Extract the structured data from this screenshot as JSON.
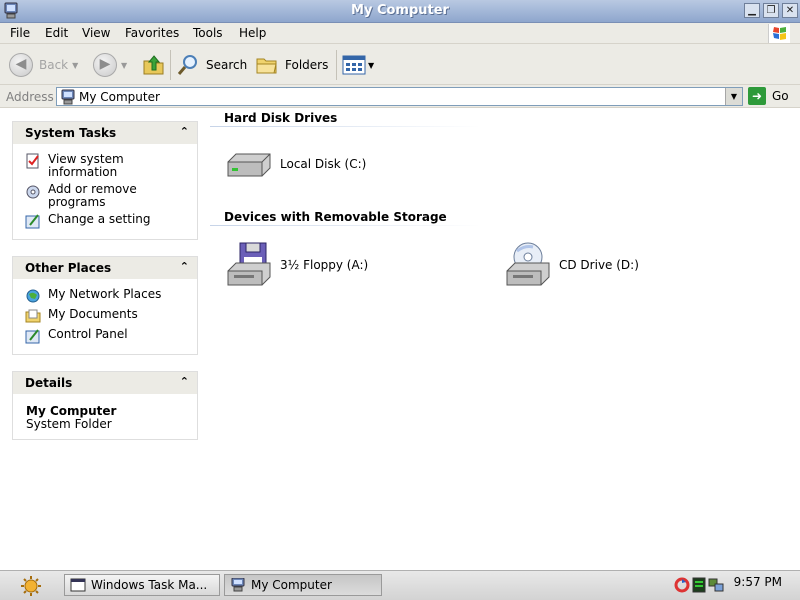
{
  "window": {
    "title": "My Computer",
    "controls": [
      "minimize",
      "restore",
      "close"
    ]
  },
  "menubar": {
    "items": [
      "File",
      "Edit",
      "View",
      "Favorites",
      "Tools",
      "Help"
    ]
  },
  "toolbar": {
    "back_label": "Back",
    "search_label": "Search",
    "folders_label": "Folders"
  },
  "address": {
    "label": "Address",
    "value": "My Computer",
    "go_label": "Go"
  },
  "task_pane": {
    "system_tasks": {
      "title": "System Tasks",
      "items": [
        "View system information",
        "Add or remove programs",
        "Change a setting"
      ]
    },
    "other_places": {
      "title": "Other Places",
      "items": [
        "My Network Places",
        "My Documents",
        "Control Panel"
      ]
    },
    "details": {
      "title": "Details",
      "name": "My Computer",
      "type": "System Folder"
    }
  },
  "content": {
    "hard_disk_drives": {
      "title": "Hard Disk Drives",
      "items": [
        "Local Disk (C:)"
      ]
    },
    "removable_storage": {
      "title": "Devices with Removable Storage",
      "items": [
        "3½ Floppy (A:)",
        "CD Drive (D:)"
      ]
    }
  },
  "taskbar": {
    "buttons": [
      "Windows Task Ma...",
      "My Computer"
    ],
    "active_button": "My Computer",
    "clock": "9:57 PM"
  },
  "colors": {
    "titlebar": "#8ea6cd",
    "chrome": "#ecebe5",
    "go_green": "#2e9a3a"
  }
}
